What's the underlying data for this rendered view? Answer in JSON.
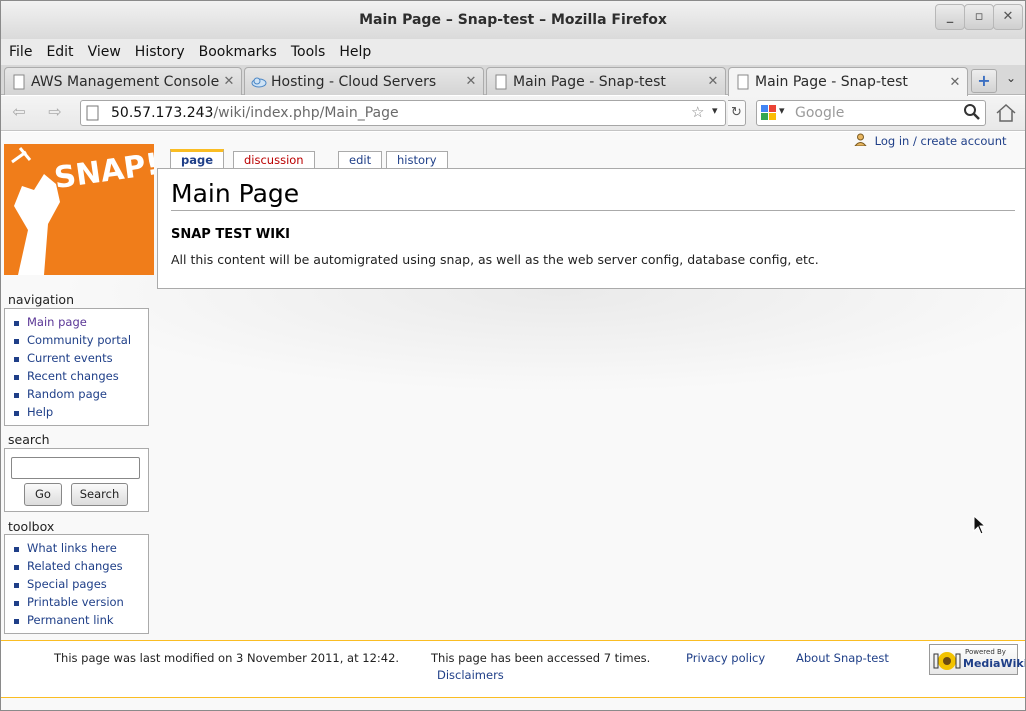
{
  "window": {
    "title": "Main Page – Snap-test – Mozilla Firefox"
  },
  "menu": [
    "File",
    "Edit",
    "View",
    "History",
    "Bookmarks",
    "Tools",
    "Help"
  ],
  "tabs": [
    {
      "label": "AWS Management Console"
    },
    {
      "label": "Hosting - Cloud Servers"
    },
    {
      "label": "Main Page - Snap-test"
    },
    {
      "label": "Main Page - Snap-test"
    }
  ],
  "urlbar": {
    "host": "50.57.173.243",
    "path": "/wiki/index.php/Main_Page"
  },
  "search": {
    "placeholder": "Google"
  },
  "wiki": {
    "logo_text": "SNAP!",
    "user_link": "Log in / create account",
    "page_tabs": {
      "page": "page",
      "discussion": "discussion",
      "edit": "edit",
      "history": "history"
    },
    "title": "Main Page",
    "heading": "SNAP TEST WIKI",
    "body": "All this content will be automigrated using snap, as well as the web server config, database config, etc.",
    "navigation": {
      "title": "navigation",
      "items": [
        "Main page",
        "Community portal",
        "Current events",
        "Recent changes",
        "Random page",
        "Help"
      ]
    },
    "search": {
      "title": "search",
      "go": "Go",
      "search": "Search"
    },
    "toolbox": {
      "title": "toolbox",
      "items": [
        "What links here",
        "Related changes",
        "Special pages",
        "Printable version",
        "Permanent link"
      ]
    },
    "footer": {
      "modified": "This page was last modified on 3 November 2011, at 12:42.",
      "accessed": "This page has been accessed 7 times.",
      "privacy": "Privacy policy",
      "about": "About Snap-test",
      "disclaimers": "Disclaimers",
      "badge_top": "Powered By",
      "badge_bottom": "MediaWiki"
    }
  }
}
